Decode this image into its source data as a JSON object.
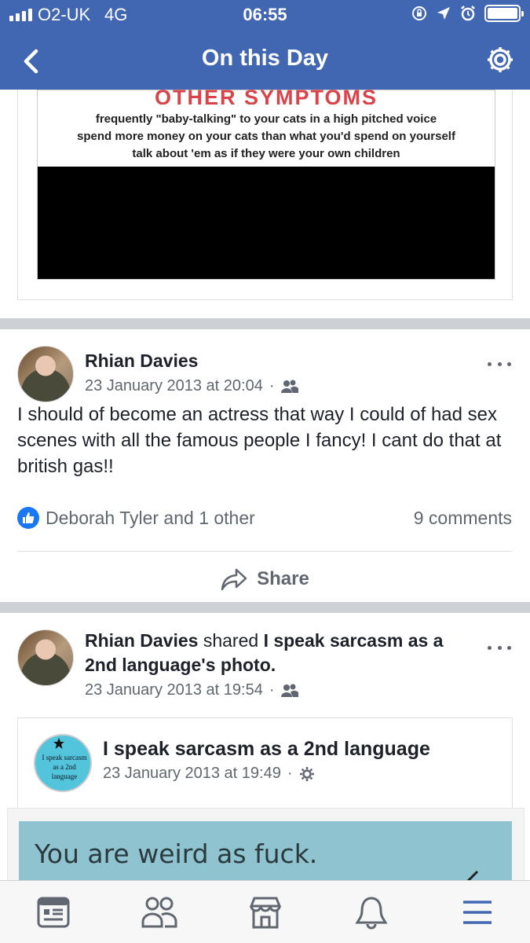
{
  "status_bar": {
    "carrier": "O2-UK",
    "network": "4G",
    "time": "06:55"
  },
  "nav": {
    "title": "On this Day",
    "back_icon": "chevron-left-icon",
    "settings_icon": "gear-icon"
  },
  "colors": {
    "brand_blue": "#4267b2",
    "like_blue": "#1877f2",
    "meme_red": "#d9434a",
    "active_tab": "#4267b2"
  },
  "memory_image": {
    "heading": "OTHER SYMPTOMS",
    "lines": [
      "frequently \"baby-talking\" to your cats in a high pitched voice",
      "spend more money on your cats than what  you'd spend on yourself",
      "talk about 'em as if they were your own children"
    ]
  },
  "post1": {
    "author": "Rhian Davies",
    "timestamp": "23 January 2013 at 20:04",
    "dot": "·",
    "audience_icon": "friends-icon",
    "text": "I should of become an actress that way I could of had sex scenes with all the famous people I fancy! I cant do that at british gas!!",
    "likes_text": "Deborah Tyler and 1 other",
    "comments_text": "9 comments",
    "share_label": "Share"
  },
  "post2": {
    "author": "Rhian Davies",
    "shared_word": "shared",
    "shared_page_possessive": "I speak sarcasm as a 2nd language",
    "shared_suffix": "'s photo.",
    "timestamp": "23 January 2013 at 19:54",
    "dot": "·",
    "audience_icon": "friends-icon",
    "shared_post": {
      "page_name": "I speak sarcasm as a 2nd language",
      "timestamp": "23 January 2013 at 19:49",
      "dot": "·",
      "audience_icon": "gear-icon",
      "avatar_text": "I speak sarcasm as a 2nd language",
      "image_text": "You are weird as fuck."
    }
  },
  "tabbar": {
    "items": [
      {
        "icon": "news-feed-icon",
        "active": false
      },
      {
        "icon": "friends-icon",
        "active": false
      },
      {
        "icon": "marketplace-icon",
        "active": false
      },
      {
        "icon": "bell-icon",
        "active": false
      },
      {
        "icon": "menu-icon",
        "active": true
      }
    ]
  }
}
